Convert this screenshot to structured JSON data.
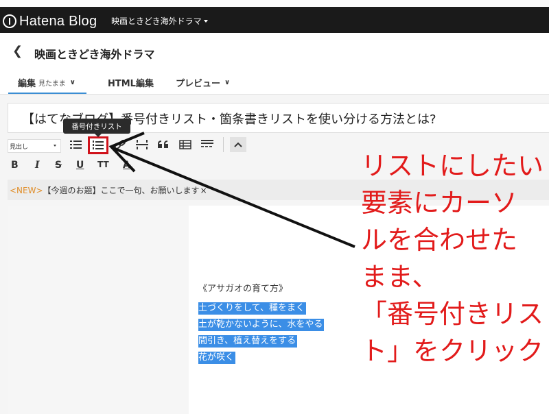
{
  "topbar": {
    "logo_text": "Hatena Blog",
    "blog_selector": "映画ときどき海外ドラマ"
  },
  "header": {
    "back_icon": "chevron-left-icon",
    "blog_title": "映画ときどき海外ドラマ"
  },
  "tabs": [
    {
      "label": "編集",
      "sub": "見たまま",
      "active": true
    },
    {
      "label": "HTML編集",
      "active": false
    },
    {
      "label": "プレビュー",
      "active": false
    }
  ],
  "editor": {
    "title": "【はてなブログ】番号付きリスト・箇条書きリストを使い分ける方法とは?",
    "style_select_value": "見出し",
    "tooltip": "番号付きリスト",
    "new_tag": "<NEW>",
    "new_text": "【今週のお題】ここで一句、お願いします",
    "new_close": "×",
    "heading_text": "《アサガオの育て方》",
    "list_items": [
      "土づくりをして、種をまく",
      "土が乾かないように、水をやる",
      "間引き、植え替えをする",
      "花が咲く"
    ],
    "format_buttons": [
      "B",
      "I",
      "S",
      "U",
      "TT",
      "A"
    ]
  },
  "annotation": {
    "lines": [
      "リストにしたい",
      "要素にカーソ",
      "ルを合わせた",
      "まま、",
      "「番号付きリス",
      "ト」をクリック"
    ]
  },
  "colors": {
    "annotation_red": "#e21b1b",
    "highlight_blue": "#3b8ee6",
    "tab_underline": "#3b8dd3",
    "topbar_bg": "#1a1a1a"
  }
}
